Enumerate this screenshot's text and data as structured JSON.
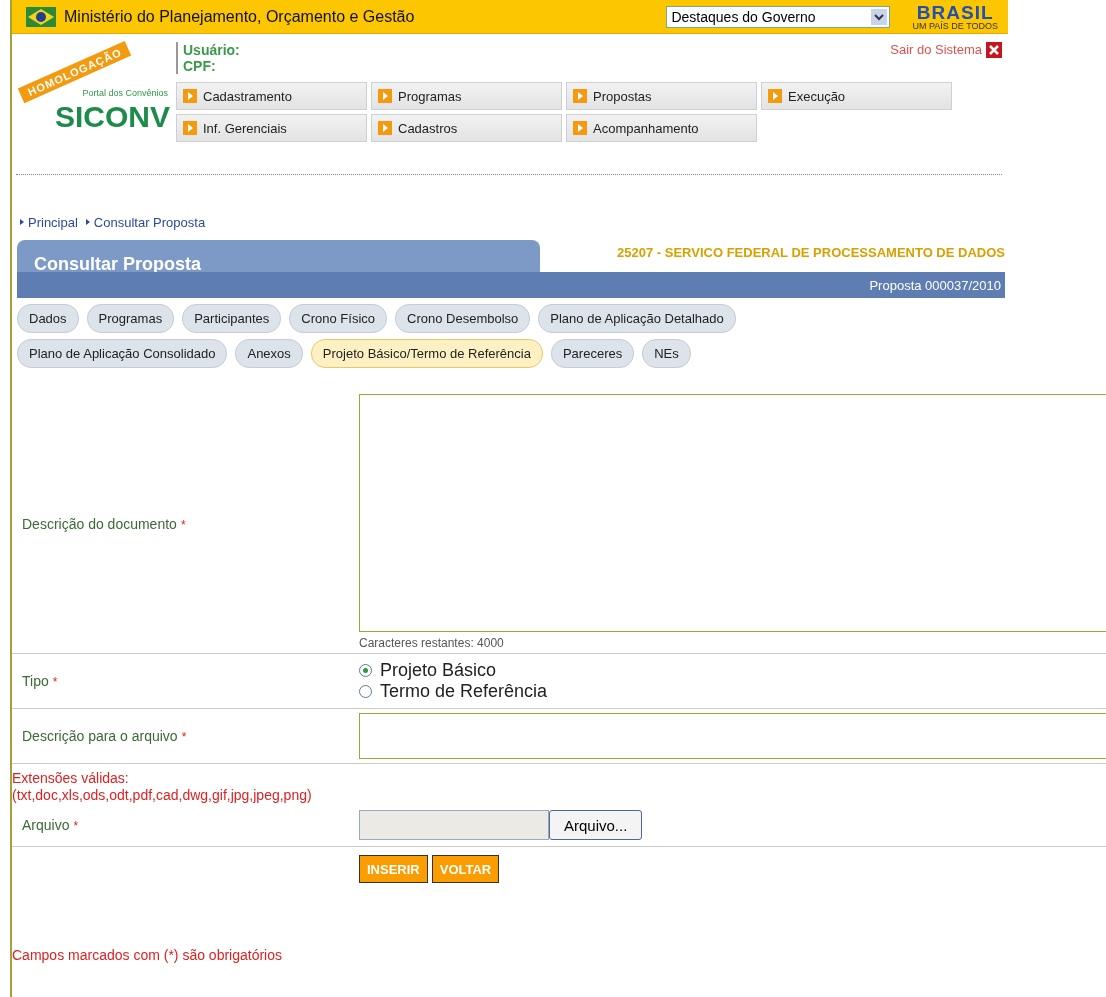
{
  "header": {
    "title": "Ministério do Planejamento, Orçamento e Gestão",
    "select_value": "Destaques do Governo",
    "brand": "BRASIL",
    "brand_tagline": "UM PAÍS DE TODOS"
  },
  "logo": {
    "ribbon": "HOMOLOGAÇÃO",
    "subtitle": "Portal dos Convênios",
    "name": "SICONV"
  },
  "user": {
    "user_label": "Usuário:",
    "cpf_label": "CPF:",
    "logout": "Sair do Sistema"
  },
  "menu": [
    {
      "label": "Cadastramento"
    },
    {
      "label": "Programas"
    },
    {
      "label": "Propostas"
    },
    {
      "label": "Execução"
    },
    {
      "label": "Inf. Gerenciais"
    },
    {
      "label": "Cadastros"
    },
    {
      "label": "Acompanhamento"
    }
  ],
  "breadcrumb": [
    {
      "label": "Principal"
    },
    {
      "label": "Consultar Proposta"
    }
  ],
  "panel": {
    "title": "Consultar Proposta",
    "organization": "25207 - SERVICO FEDERAL DE PROCESSAMENTO DE DADOS",
    "proposal": "Proposta 000037/2010"
  },
  "tabs": [
    {
      "label": "Dados",
      "selected": false
    },
    {
      "label": "Programas",
      "selected": false
    },
    {
      "label": "Participantes",
      "selected": false
    },
    {
      "label": "Crono Físico",
      "selected": false
    },
    {
      "label": "Crono Desembolso",
      "selected": false
    },
    {
      "label": "Plano de Aplicação Detalhado",
      "selected": false
    },
    {
      "label": "Plano de Aplicação Consolidado",
      "selected": false
    },
    {
      "label": "Anexos",
      "selected": false
    },
    {
      "label": "Projeto Básico/Termo de Referência",
      "selected": true
    },
    {
      "label": "Pareceres",
      "selected": false
    },
    {
      "label": "NEs",
      "selected": false
    }
  ],
  "form": {
    "required_mark": "*",
    "description": {
      "label": "Descrição do documento",
      "required": true,
      "counter": "Caracteres restantes:  4000"
    },
    "tipo": {
      "label": "Tipo",
      "required": true,
      "options": [
        {
          "label": "Projeto Básico",
          "selected": true
        },
        {
          "label": "Termo de Referência",
          "selected": false
        }
      ]
    },
    "file_description": {
      "label": "Descrição para o arquivo",
      "required": true
    },
    "extensions": [
      "Extensões válidas:",
      "(txt,doc,xls,ods,odt,pdf,cad,dwg,gif,jpg,jpeg,png)"
    ],
    "file": {
      "label": "Arquivo",
      "required": true,
      "button": "Arquivo..."
    },
    "buttons": [
      "INSERIR",
      "VOLTAR"
    ]
  },
  "footer_note": "Campos marcados com (*) são obrigatórios"
}
